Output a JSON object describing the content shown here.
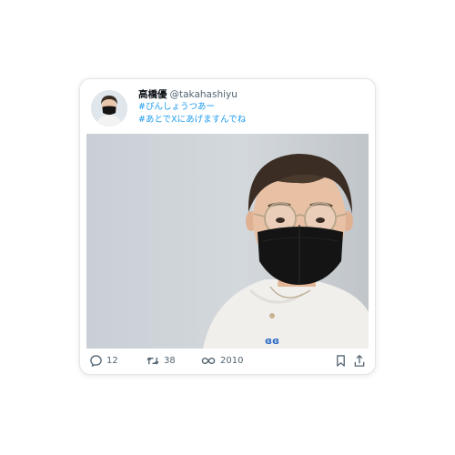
{
  "post": {
    "author_name": "高橋優",
    "author_handle": "@takahashiyu",
    "hashtags": [
      "#ぴんしょうつあー",
      "#あとでXにあげますんでね"
    ],
    "media_icon": "photo-of-man-wearing-black-mask-and-round-glasses",
    "avatar_icon": "avatar-man-with-black-mask"
  },
  "actions": {
    "reply": {
      "icon": "reply-icon",
      "count": "12"
    },
    "repost": {
      "icon": "repost-icon",
      "count": "38"
    },
    "views": {
      "icon": "views-icon",
      "count": "2010"
    },
    "bookmark": {
      "icon": "bookmark-icon"
    },
    "share": {
      "icon": "share-icon"
    }
  },
  "colors": {
    "link_blue": "#1d9bf0",
    "text_primary": "#0f1419",
    "text_secondary": "#536471",
    "mask_black": "#141414"
  }
}
